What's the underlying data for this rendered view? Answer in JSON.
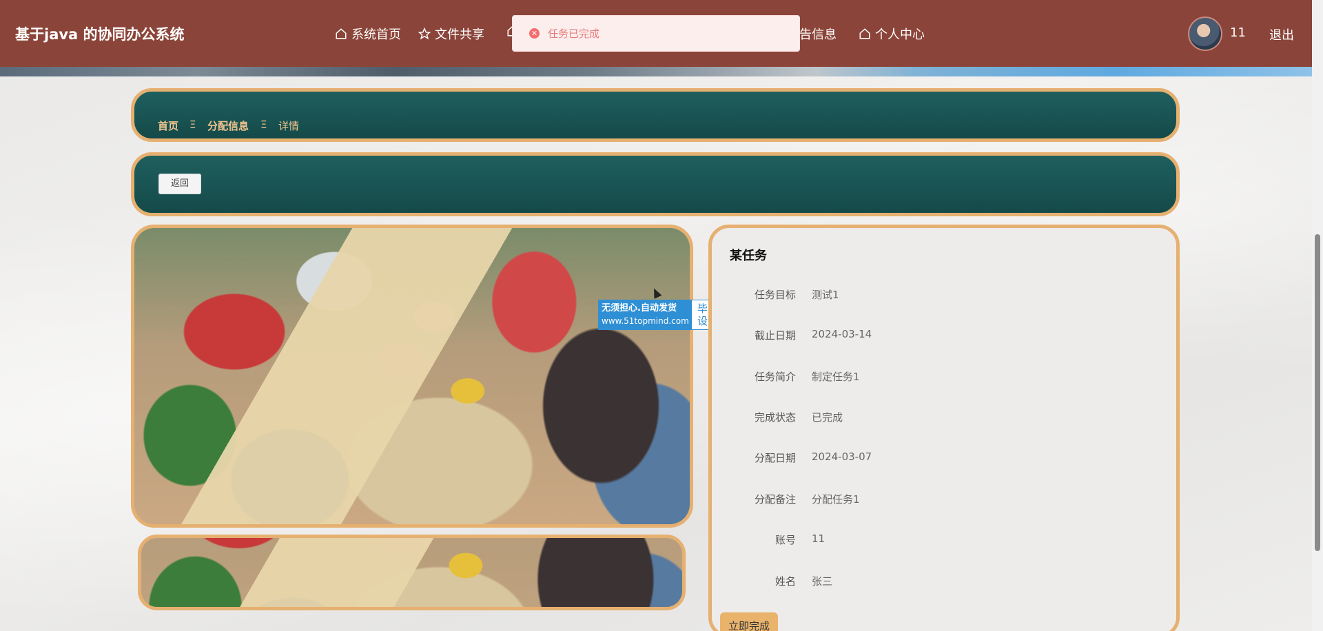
{
  "app": {
    "title": "基于java 的协同办公系统"
  },
  "nav": {
    "items": [
      {
        "label": "系统首页",
        "icon": "home-icon"
      },
      {
        "label": "文件共享",
        "icon": "star-icon"
      },
      {
        "label": "",
        "icon": "home-icon"
      },
      {
        "label": "告信息",
        "icon": ""
      },
      {
        "label": "个人中心",
        "icon": "home-icon"
      }
    ]
  },
  "user": {
    "id": "11",
    "logout_label": "退出"
  },
  "toast": {
    "message": "任务已完成",
    "icon": "error-circle-icon",
    "color": "#f56c6c"
  },
  "breadcrumb": {
    "items": [
      "首页",
      "分配信息",
      "详情"
    ],
    "separator": "Ξ"
  },
  "actions": {
    "back_label": "返回",
    "complete_label": "立即完成"
  },
  "detail": {
    "title": "某任务",
    "fields": [
      {
        "label": "任务目标",
        "value": "测试1"
      },
      {
        "label": "截止日期",
        "value": "2024-03-14"
      },
      {
        "label": "任务简介",
        "value": "制定任务1"
      },
      {
        "label": "完成状态",
        "value": "已完成"
      },
      {
        "label": "分配日期",
        "value": "2024-03-07"
      },
      {
        "label": "分配备注",
        "value": "分配任务1"
      },
      {
        "label": "账号",
        "value": "11"
      },
      {
        "label": "姓名",
        "value": "张三"
      }
    ]
  },
  "watermark": {
    "line1": "无须担心.自动发货",
    "line2": "www.51topmind.com",
    "side1": "毕业",
    "side2": "设计"
  },
  "colors": {
    "header": "#8b4439",
    "panel": "#1f5f5e",
    "accent": "#e6b070"
  }
}
